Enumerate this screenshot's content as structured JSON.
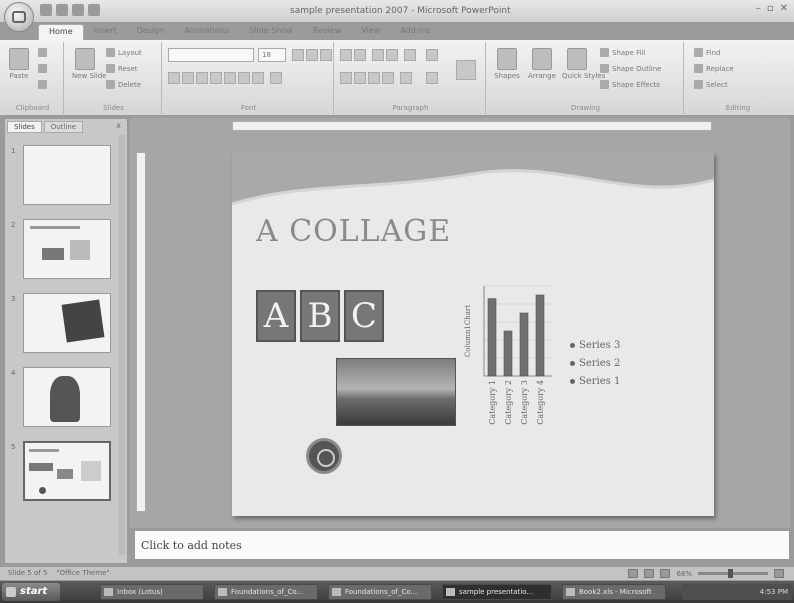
{
  "window": {
    "title": "sample presentation 2007 - Microsoft PowerPoint",
    "controls": [
      "–",
      "▫",
      "✕"
    ]
  },
  "tabs": [
    {
      "label": "Home",
      "active": true
    },
    {
      "label": "Insert"
    },
    {
      "label": "Design"
    },
    {
      "label": "Animations"
    },
    {
      "label": "Slide Show"
    },
    {
      "label": "Review"
    },
    {
      "label": "View"
    },
    {
      "label": "Add-Ins"
    }
  ],
  "ribbon": {
    "clipboard": {
      "group": "Clipboard",
      "paste": "Paste",
      "cut": "Cut",
      "copy": "Copy",
      "format_painter": "Format Painter"
    },
    "slides": {
      "group": "Slides",
      "new_slide": "New Slide",
      "layout": "Layout",
      "reset": "Reset",
      "delete": "Delete"
    },
    "font": {
      "group": "Font",
      "size": "18"
    },
    "paragraph": {
      "group": "Paragraph"
    },
    "drawing": {
      "group": "Drawing",
      "shapes": "Shapes",
      "arrange": "Arrange",
      "quick_styles": "Quick Styles",
      "shape_fill": "Shape Fill",
      "shape_outline": "Shape Outline",
      "shape_effects": "Shape Effects"
    },
    "editing": {
      "group": "Editing",
      "find": "Find",
      "replace": "Replace",
      "select": "Select"
    }
  },
  "left_panel": {
    "tabs": [
      "Slides",
      "Outline"
    ],
    "close": "x",
    "slides": [
      {
        "num": "1"
      },
      {
        "num": "2"
      },
      {
        "num": "3"
      },
      {
        "num": "4"
      },
      {
        "num": "5"
      }
    ]
  },
  "slide": {
    "title": "A COLLAGE",
    "letters": [
      "A",
      "B",
      "C"
    ]
  },
  "chart_data": {
    "type": "bar",
    "categories": [
      "Category 1",
      "Category 2",
      "Category 3",
      "Category 4"
    ],
    "series": [
      {
        "name": "Series 1",
        "values": [
          4.3,
          2.5,
          3.5,
          4.5
        ]
      }
    ],
    "legend": [
      "Series 3",
      "Series 2",
      "Series 1"
    ],
    "ylabel": "Column1Chart",
    "ylim": [
      0,
      5
    ]
  },
  "notes": {
    "placeholder": "Click to add notes"
  },
  "status": {
    "slide_info": "Slide 5 of 5",
    "theme": "\"Office Theme\"",
    "zoom": "68%"
  },
  "taskbar": {
    "start": "start",
    "tasks": [
      {
        "label": "Inbox (Lotus)"
      },
      {
        "label": "Foundations_of_Co..."
      },
      {
        "label": "Foundations_of_Co..."
      },
      {
        "label": "sample presentatio...",
        "active": true
      },
      {
        "label": "Book2.xls - Microsoft"
      }
    ],
    "clock": "4:53 PM"
  }
}
